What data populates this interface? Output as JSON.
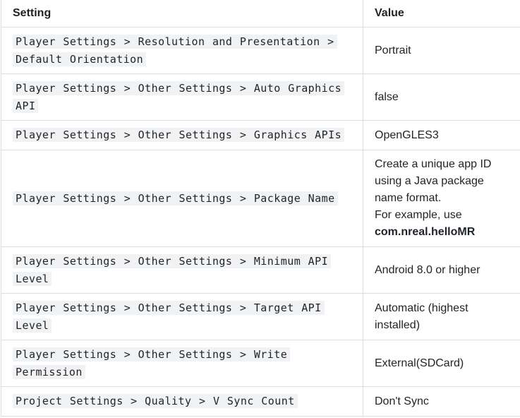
{
  "table": {
    "headers": {
      "setting": "Setting",
      "value": "Value"
    },
    "rows": [
      {
        "setting": "Player Settings > Resolution and Presentation > Default Orientation",
        "value": "Portrait"
      },
      {
        "setting": "Player Settings > Other Settings > Auto Graphics API",
        "value": "false"
      },
      {
        "setting": "Player Settings > Other Settings > Graphics APIs",
        "value": "OpenGLES3"
      },
      {
        "setting": "Player Settings > Other Settings > Package Name",
        "value_line1": "Create a unique app ID using a Java package name format.",
        "value_line2": "For example, use",
        "value_strong": "com.nreal.helloMR"
      },
      {
        "setting": "Player Settings > Other Settings > Minimum API Level",
        "value": "Android 8.0 or higher"
      },
      {
        "setting": "Player Settings > Other Settings > Target API Level",
        "value": "Automatic (highest installed)"
      },
      {
        "setting": "Player Settings > Other Settings > Write Permission",
        "value": "External(SDCard)"
      },
      {
        "setting": "Project Settings > Quality > V Sync Count",
        "value": "Don't Sync"
      }
    ]
  }
}
